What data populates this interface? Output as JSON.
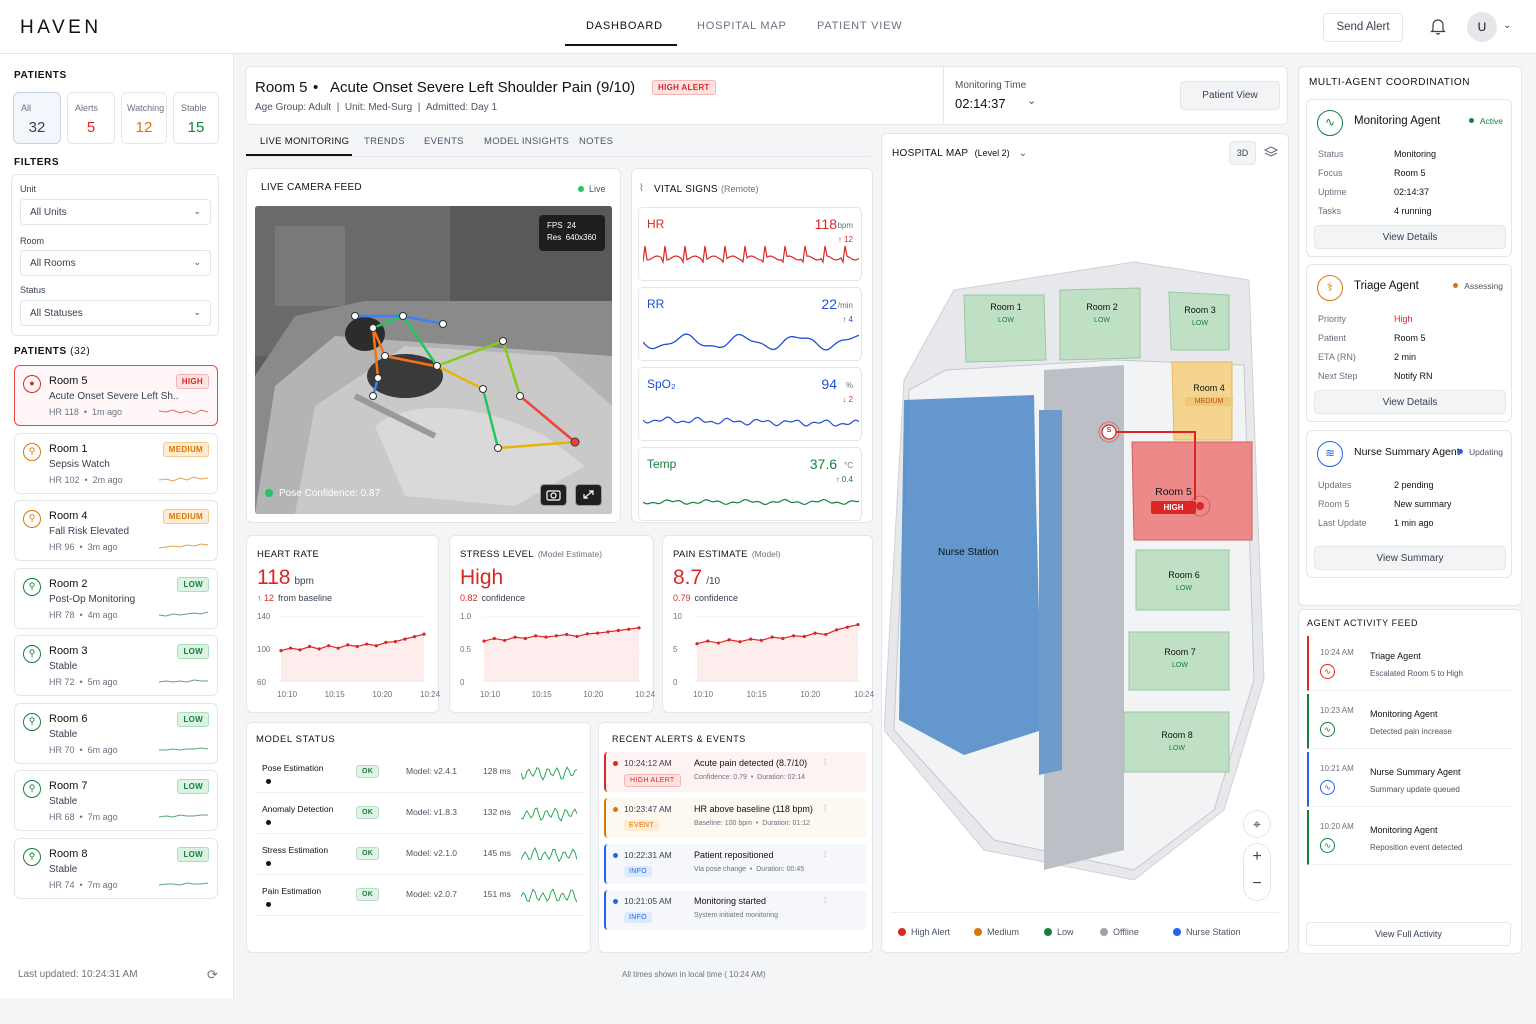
{
  "app": {
    "brand": "HAVEN"
  },
  "nav": {
    "tabs": [
      "DASHBOARD",
      "HOSPITAL MAP",
      "PATIENT VIEW"
    ],
    "active": "DASHBOARD"
  },
  "header": {
    "send_alert": "Send Alert",
    "avatar": "U"
  },
  "sidebar": {
    "patients_title": "PATIENTS",
    "stats": [
      {
        "label": "All",
        "value": "32",
        "color": "#374151"
      },
      {
        "label": "Alerts",
        "value": "5",
        "color": "#dc2626"
      },
      {
        "label": "Watching",
        "value": "12",
        "color": "#d97706"
      },
      {
        "label": "Stable",
        "value": "15",
        "color": "#15803d"
      }
    ],
    "filters_title": "FILTERS",
    "filters": [
      {
        "label": "Unit",
        "value": "All Units"
      },
      {
        "label": "Room",
        "value": "All Rooms"
      },
      {
        "label": "Status",
        "value": "All Statuses"
      }
    ],
    "list_title": "PATIENTS",
    "list_count": "(32)",
    "patients": [
      {
        "room": "Room 5",
        "desc": "Acute Onset Severe Left Sh...",
        "hr": "HR 118",
        "ago": "1m ago",
        "badge": "HIGH",
        "level": "high"
      },
      {
        "room": "Room 1",
        "desc": "Sepsis Watch",
        "hr": "HR 102",
        "ago": "2m ago",
        "badge": "MEDIUM",
        "level": "med"
      },
      {
        "room": "Room 4",
        "desc": "Fall Risk Elevated",
        "hr": "HR 96",
        "ago": "3m ago",
        "badge": "MEDIUM",
        "level": "med"
      },
      {
        "room": "Room 2",
        "desc": "Post-Op Monitoring",
        "hr": "HR 78",
        "ago": "4m ago",
        "badge": "LOW",
        "level": "low"
      },
      {
        "room": "Room 3",
        "desc": "Stable",
        "hr": "HR 72",
        "ago": "5m ago",
        "badge": "LOW",
        "level": "low"
      },
      {
        "room": "Room 6",
        "desc": "Stable",
        "hr": "HR 70",
        "ago": "6m ago",
        "badge": "LOW",
        "level": "low"
      },
      {
        "room": "Room 7",
        "desc": "Stable",
        "hr": "HR 68",
        "ago": "7m ago",
        "badge": "LOW",
        "level": "low"
      },
      {
        "room": "Room 8",
        "desc": "Stable",
        "hr": "HR 74",
        "ago": "7m ago",
        "badge": "LOW",
        "level": "low"
      }
    ],
    "last_updated": "Last updated: 10:24:31 AM"
  },
  "patient": {
    "room": "Room 5",
    "title": "Acute Onset Severe Left Shoulder Pain (9/10)",
    "alert": "HIGH ALERT",
    "age": "Age Group: Adult",
    "unit": "Unit: Med-Surg",
    "admitted": "Admitted: Day 1",
    "monitoring_label": "Monitoring Time",
    "monitoring_time": "02:14:37",
    "view_button": "Patient View"
  },
  "tabs": [
    "LIVE MONITORING",
    "TRENDS",
    "EVENTS",
    "MODEL INSIGHTS",
    "NOTES"
  ],
  "camera": {
    "title": "LIVE CAMERA FEED",
    "live": "Live",
    "fps_label": "FPS",
    "fps": "24",
    "res_label": "Res",
    "res": "640x360",
    "confidence": "Pose Confidence: 0.87"
  },
  "vitals": {
    "title": "VITAL SIGNS",
    "subtitle": "(Remote)",
    "items": [
      {
        "label": "HR",
        "value": "118",
        "unit": "bpm",
        "delta": "↑ 12",
        "color": "#dc2626"
      },
      {
        "label": "RR",
        "value": "22",
        "unit": "/min",
        "delta": "↑ 4",
        "color": "#1d4ed8"
      },
      {
        "label": "SpO₂",
        "value": "94",
        "unit": "%",
        "delta": "↓ 2",
        "color": "#1d4ed8"
      },
      {
        "label": "Temp",
        "value": "37.6",
        "unit": "°C",
        "delta": "↑ 0.4",
        "color": "#15803d"
      }
    ]
  },
  "metrics": [
    {
      "title": "HEART RATE",
      "sub": "",
      "value": "118",
      "unit": "bpm",
      "note1": "↑ 12",
      "note2": "from baseline",
      "ylim": [
        "140",
        "100",
        "60"
      ],
      "x": [
        "10:10",
        "10:15",
        "10:20",
        "10:24"
      ]
    },
    {
      "title": "STRESS LEVEL",
      "sub": "(Model Estimate)",
      "value": "High",
      "unit": "",
      "note1": "0.82",
      "note2": "confidence",
      "ylim": [
        "1.0",
        "0.5",
        "0"
      ],
      "x": [
        "10:10",
        "10:15",
        "10:20",
        "10:24"
      ]
    },
    {
      "title": "PAIN ESTIMATE",
      "sub": "(Model)",
      "value": "8.7",
      "unit": "/10",
      "note1": "0.79",
      "note2": "confidence",
      "ylim": [
        "10",
        "5",
        "0"
      ],
      "x": [
        "10:10",
        "10:15",
        "10:20",
        "10:24"
      ]
    }
  ],
  "model_status": {
    "title": "MODEL STATUS",
    "rows": [
      {
        "name": "Pose Estimation",
        "status": "OK",
        "model": "Model: v2.4.1",
        "latency": "128 ms"
      },
      {
        "name": "Anomaly Detection",
        "status": "OK",
        "model": "Model: v1.8.3",
        "latency": "132 ms"
      },
      {
        "name": "Stress Estimation",
        "status": "OK",
        "model": "Model: v2.1.0",
        "latency": "145 ms"
      },
      {
        "name": "Pain Estimation",
        "status": "OK",
        "model": "Model: v2.0.7",
        "latency": "151 ms"
      }
    ]
  },
  "alerts": {
    "title": "RECENT ALERTS & EVENTS",
    "rows": [
      {
        "time": "10:24:12 AM",
        "tag": "HIGH ALERT",
        "title": "Acute pain detected (8.7/10)",
        "detail": "Confidence: 0.79  •  Duration: 02:14",
        "color": "#dc2626"
      },
      {
        "time": "10:23:47 AM",
        "tag": "EVENT",
        "title": "HR above baseline (118 bpm)",
        "detail": "Baseline: 100 bpm  •  Duration: 01:12",
        "color": "#d97706"
      },
      {
        "time": "10:22:31 AM",
        "tag": "INFO",
        "title": "Patient repositioned",
        "detail": "Via pose change  •  Duration: 00:45",
        "color": "#2563eb"
      },
      {
        "time": "10:21:05 AM",
        "tag": "INFO",
        "title": "Monitoring started",
        "detail": "System initiated monitoring",
        "color": "#2563eb"
      }
    ]
  },
  "footer_note": "All times shown in local time ( 10:24 AM)",
  "map": {
    "title": "HOSPITAL MAP",
    "level": "(Level 2)",
    "toggle_3d": "3D",
    "rooms": [
      {
        "name": "Room 1",
        "status": "LOW"
      },
      {
        "name": "Room 2",
        "status": "LOW"
      },
      {
        "name": "Room 3",
        "status": "LOW"
      },
      {
        "name": "Room 4",
        "status": "MEDIUM"
      },
      {
        "name": "Room 5",
        "status": "HIGH"
      },
      {
        "name": "Room 6",
        "status": "LOW"
      },
      {
        "name": "Room 7",
        "status": "LOW"
      },
      {
        "name": "Room 8",
        "status": "LOW"
      }
    ],
    "nurse_station": "Nurse Station",
    "marker": "S",
    "legend": [
      {
        "label": "High Alert",
        "color": "#dc2626"
      },
      {
        "label": "Medium",
        "color": "#d97706"
      },
      {
        "label": "Low",
        "color": "#15803d"
      },
      {
        "label": "Offline",
        "color": "#9ca3af"
      },
      {
        "label": "Nurse Station",
        "color": "#2563eb"
      }
    ]
  },
  "agents": {
    "title": "MULTI-AGENT COORDINATION",
    "list": [
      {
        "name": "Monitoring Agent",
        "state": "Active",
        "rows": [
          [
            "Status",
            "Monitoring"
          ],
          [
            "Focus",
            "Room 5"
          ],
          [
            "Uptime",
            "02:14:37"
          ],
          [
            "Tasks",
            "4 running"
          ]
        ],
        "button": "View Details"
      },
      {
        "name": "Triage Agent",
        "state": "Assessing",
        "rows": [
          [
            "Priority",
            "High"
          ],
          [
            "Patient",
            "Room 5"
          ],
          [
            "ETA (RN)",
            "2 min"
          ],
          [
            "Next Step",
            "Notify RN"
          ]
        ],
        "button": "View Details"
      },
      {
        "name": "Nurse Summary Agent",
        "state": "Updating",
        "rows": [
          [
            "Updates",
            "2 pending"
          ],
          [
            "Room 5",
            "New summary"
          ],
          [
            "Last Update",
            "1 min ago"
          ]
        ],
        "button": "View Summary"
      }
    ]
  },
  "feed": {
    "title": "AGENT ACTIVITY FEED",
    "rows": [
      {
        "time": "10:24 AM",
        "agent": "Triage Agent",
        "text": "Escalated Room 5 to High"
      },
      {
        "time": "10:23 AM",
        "agent": "Monitoring Agent",
        "text": "Detected pain increase"
      },
      {
        "time": "10:21 AM",
        "agent": "Nurse Summary Agent",
        "text": "Summary update queued"
      },
      {
        "time": "10:20 AM",
        "agent": "Monitoring Agent",
        "text": "Reposition event detected"
      }
    ],
    "button": "View Full Activity"
  }
}
